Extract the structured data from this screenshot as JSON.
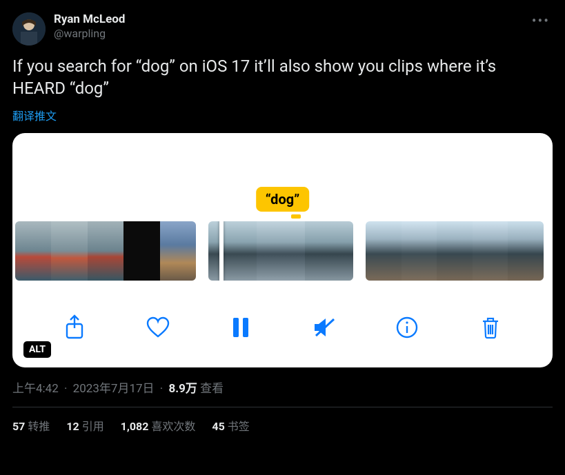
{
  "author": {
    "display_name": "Ryan McLeod",
    "handle": "@warpling"
  },
  "body": "If you search for “dog” on iOS 17 it’ll also show you clips where it’s HEARD “dog”",
  "translate_label": "翻译推文",
  "media": {
    "bubble_text": "“dog”",
    "alt_badge": "ALT"
  },
  "meta": {
    "time": "上午4:42",
    "date": "2023年7月17日",
    "views_count": "8.9万",
    "views_label": "查看"
  },
  "stats": {
    "retweets_count": "57",
    "retweets_label": "转推",
    "quotes_count": "12",
    "quotes_label": "引用",
    "likes_count": "1,082",
    "likes_label": "喜欢次数",
    "bookmarks_count": "45",
    "bookmarks_label": "书签"
  }
}
